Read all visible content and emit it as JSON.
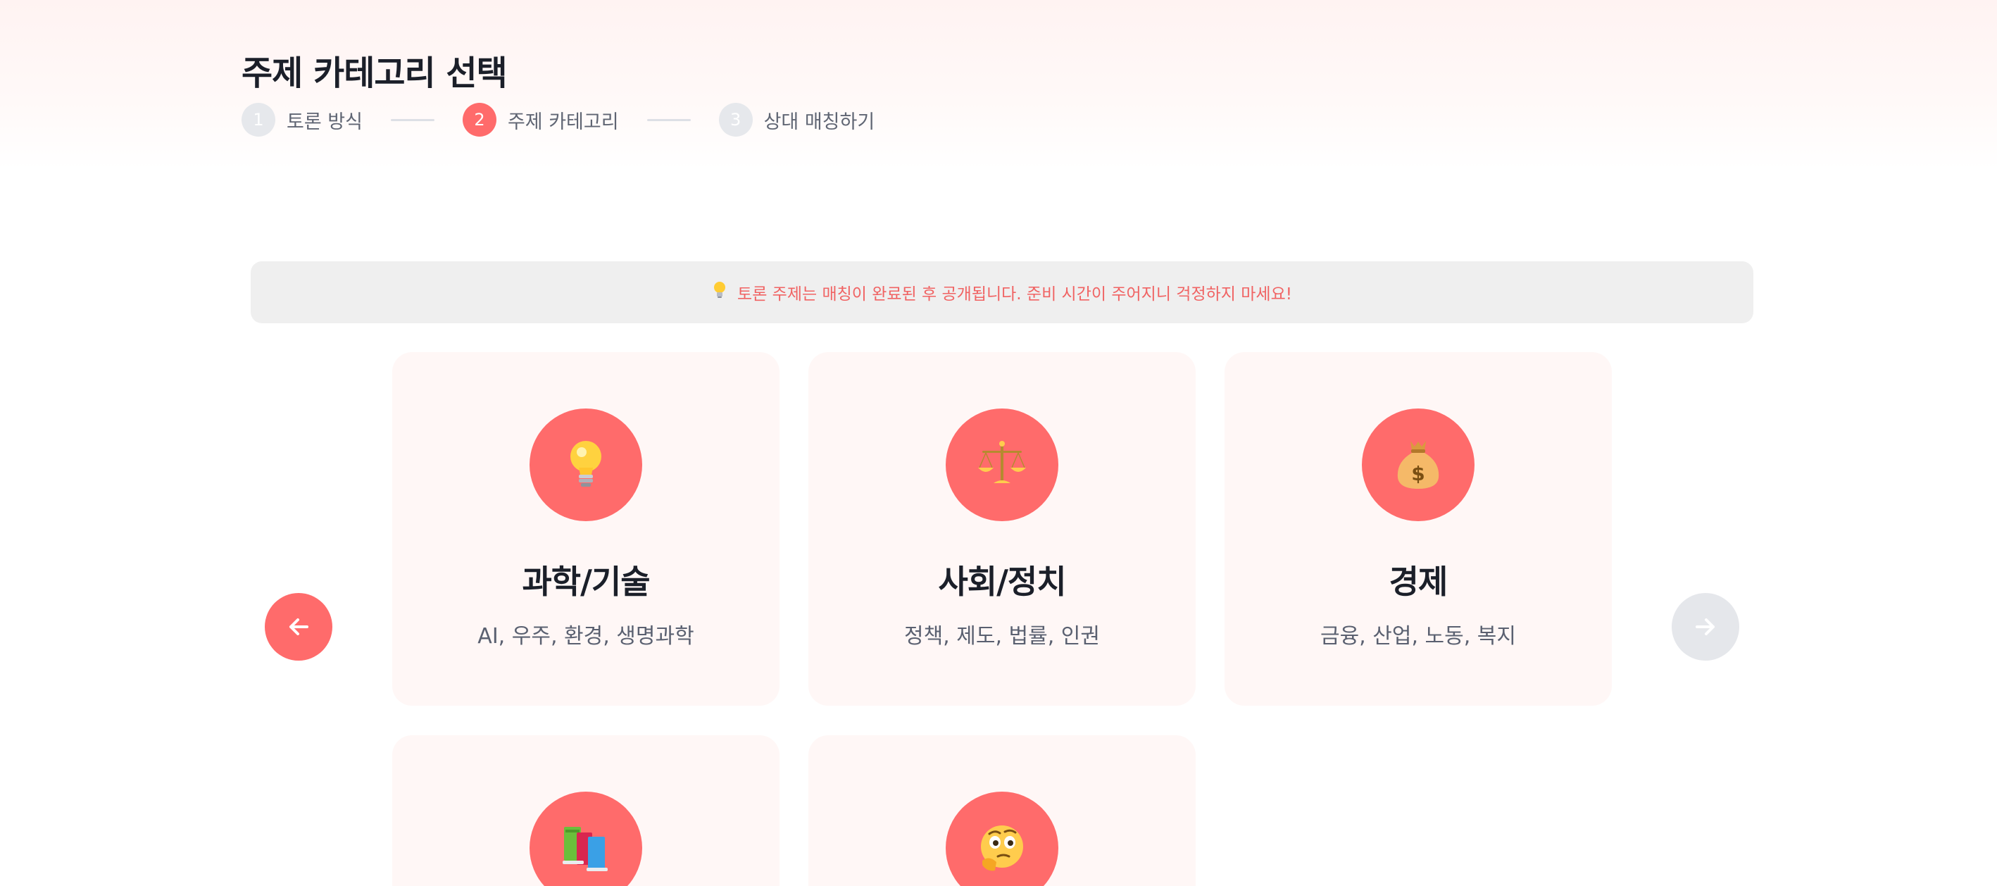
{
  "header": {
    "title": "주제 카테고리 선택",
    "steps": [
      {
        "number": "1",
        "label": "토론 방식",
        "state": "done"
      },
      {
        "number": "2",
        "label": "주제 카테고리",
        "state": "active"
      },
      {
        "number": "3",
        "label": "상대 매칭하기",
        "state": "pending"
      }
    ]
  },
  "notice": {
    "icon": "lightbulb-icon",
    "text": "토론 주제는 매칭이 완료된 후 공개됩니다. 준비 시간이 주어지니 걱정하지 마세요!"
  },
  "carousel": {
    "prev_icon": "arrow-left-icon",
    "next_icon": "arrow-right-icon",
    "prev_enabled": true,
    "next_enabled": false
  },
  "categories": [
    {
      "icon": "lightbulb-icon",
      "title": "과학/기술",
      "desc": "AI, 우주, 환경, 생명과학"
    },
    {
      "icon": "scales-icon",
      "title": "사회/정치",
      "desc": "정책, 제도, 법률, 인권"
    },
    {
      "icon": "money-bag-icon",
      "title": "경제",
      "desc": "금융, 산업, 노동, 복지"
    },
    {
      "icon": "books-icon",
      "title": "",
      "desc": ""
    },
    {
      "icon": "thinking-face-icon",
      "title": "",
      "desc": ""
    }
  ],
  "colors": {
    "accent": "#ff6b6b",
    "card_bg": "#fff7f6",
    "notice_bg": "#efefef",
    "notice_text": "#f06363",
    "disabled": "#e5e7eb"
  }
}
